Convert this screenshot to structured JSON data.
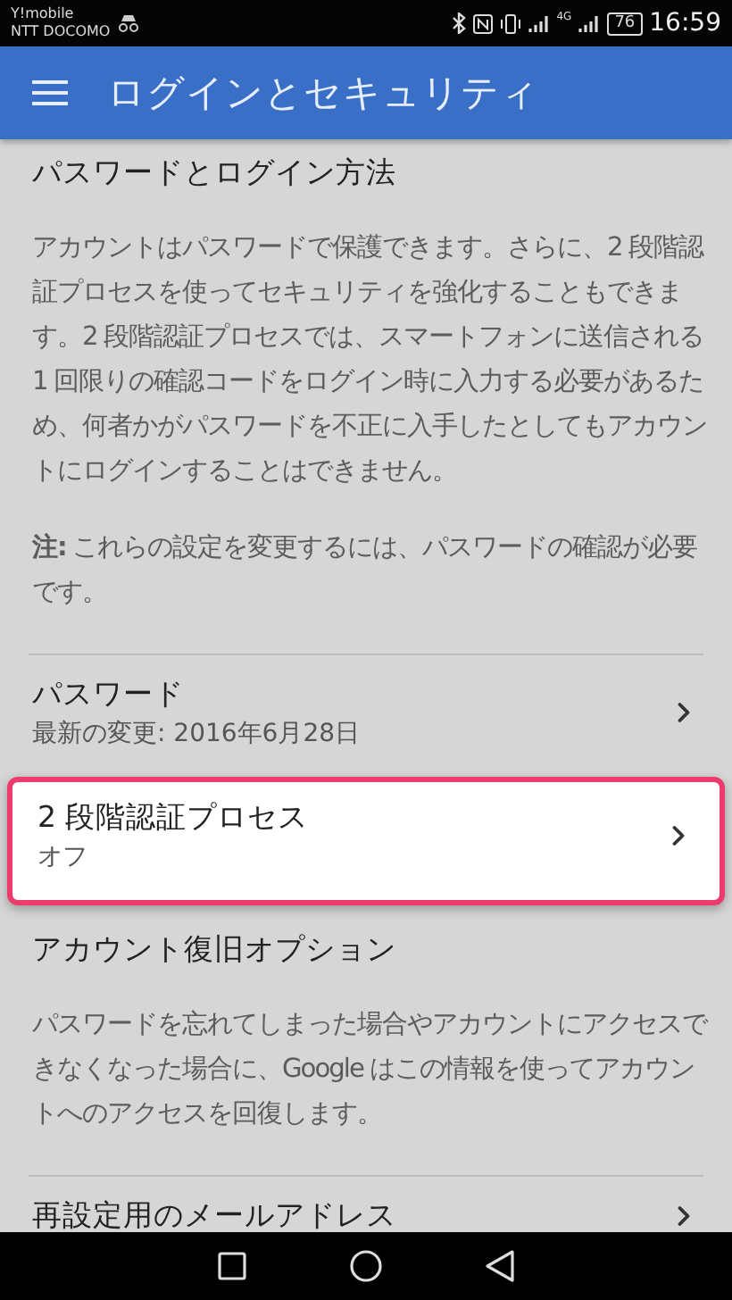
{
  "status_bar": {
    "carriers": [
      "Y!mobile",
      "NTT DOCOMO"
    ],
    "network_type": "4G",
    "battery": "76",
    "time": "16:59"
  },
  "app_bar": {
    "title": "ログインとセキュリティ"
  },
  "sections": [
    {
      "title": "パスワードとログイン方法",
      "paragraphs": [
        "アカウントはパスワードで保護できます。さらに、2 段階認証プロセスを使ってセキュリティを強化することもできます。2 段階認証プロセスでは、スマートフォンに送信される 1 回限りの確認コードをログイン時に入力する必要があるため、何者かがパスワードを不正に入手したとしてもアカウントにログインすることはできません。",
        "**注:** これらの設定を変更するには、パスワードの確認が必要です。"
      ],
      "rows": [
        {
          "label": "パスワード",
          "detail": "最新の変更: 2016年6月28日",
          "highlighted": false
        },
        {
          "label": "2 段階認証プロセス",
          "detail": "オフ",
          "highlighted": true
        }
      ]
    },
    {
      "title": "アカウント復旧オプション",
      "paragraphs": [
        "パスワードを忘れてしまった場合やアカウントにアクセスできなくなった場合に、Google はこの情報を使ってアカウントへのアクセスを回復します。"
      ],
      "rows": [
        {
          "label": "再設定用のメールアドレス",
          "highlighted": false
        }
      ]
    }
  ]
}
